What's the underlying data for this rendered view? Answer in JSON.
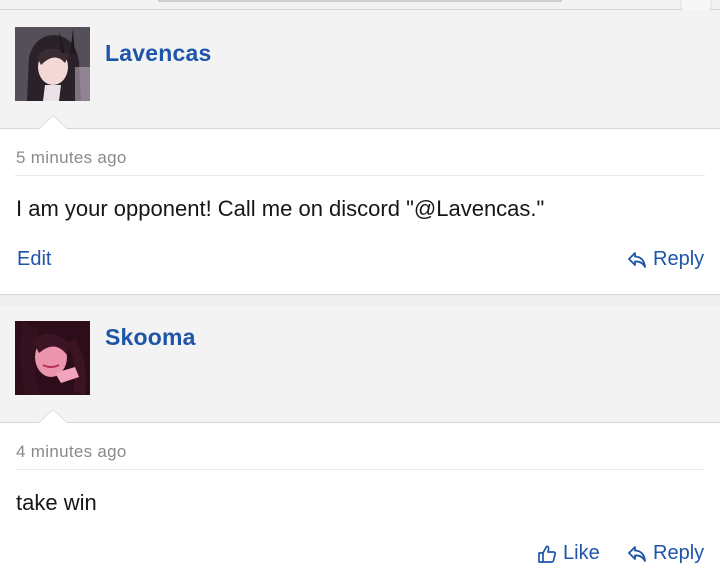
{
  "comments": [
    {
      "username": "Lavencas",
      "time": "5 minutes ago",
      "text": "I am your opponent! Call me on discord \"@Lavencas.\"",
      "actions": {
        "edit": "Edit",
        "reply": "Reply"
      }
    },
    {
      "username": "Skooma",
      "time": "4 minutes ago",
      "text": "take win",
      "actions": {
        "like": "Like",
        "reply": "Reply"
      }
    }
  ],
  "colors": {
    "link": "#1e55a8",
    "muted": "#8a8a8a",
    "header_bg": "#f3f3f3"
  },
  "icons": {
    "reply": "reply-arrow-icon",
    "like": "thumbs-up-icon"
  }
}
